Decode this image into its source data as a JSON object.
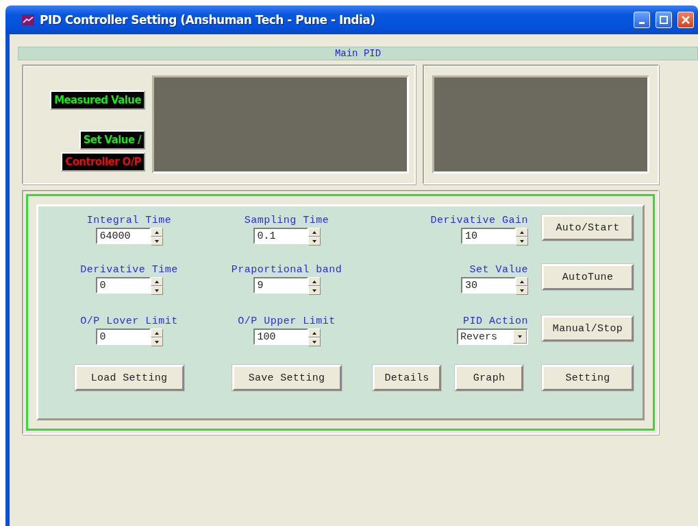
{
  "window": {
    "title": "PID Controller Setting (Anshuman Tech - Pune - India)"
  },
  "section_title": "Main PID",
  "indicators": [
    {
      "label": "Measured Value",
      "kind": "input"
    },
    {
      "label": "Set Value  /",
      "kind": "input"
    },
    {
      "label": "Controller O/P",
      "kind": "output"
    }
  ],
  "parameters": [
    {
      "kind": "spinner",
      "label": "Integral Time",
      "value": "64000"
    },
    {
      "kind": "spinner",
      "label": "Sampling Time",
      "value": "0.1"
    },
    {
      "kind": "spinner",
      "label": "Derivative Gain",
      "value": "10"
    },
    {
      "kind": "spinner",
      "label": "Derivative Time",
      "value": "0"
    },
    {
      "kind": "spinner",
      "label": "Praportional band",
      "value": "9"
    },
    {
      "kind": "spinner",
      "label": "Set Value",
      "value": "30"
    },
    {
      "kind": "spinner",
      "label": "O/P Lover Limit",
      "value": "0"
    },
    {
      "kind": "spinner",
      "label": "O/P Upper Limit",
      "value": "100"
    },
    {
      "kind": "dropdown",
      "label": "PID Action",
      "value": "Revers"
    }
  ],
  "side_buttons": [
    "Auto/Start",
    "AutoTune",
    "Manual/Stop"
  ],
  "bottom_buttons": [
    "Load Setting",
    "Save Setting",
    "Details",
    "Graph",
    "Setting"
  ]
}
